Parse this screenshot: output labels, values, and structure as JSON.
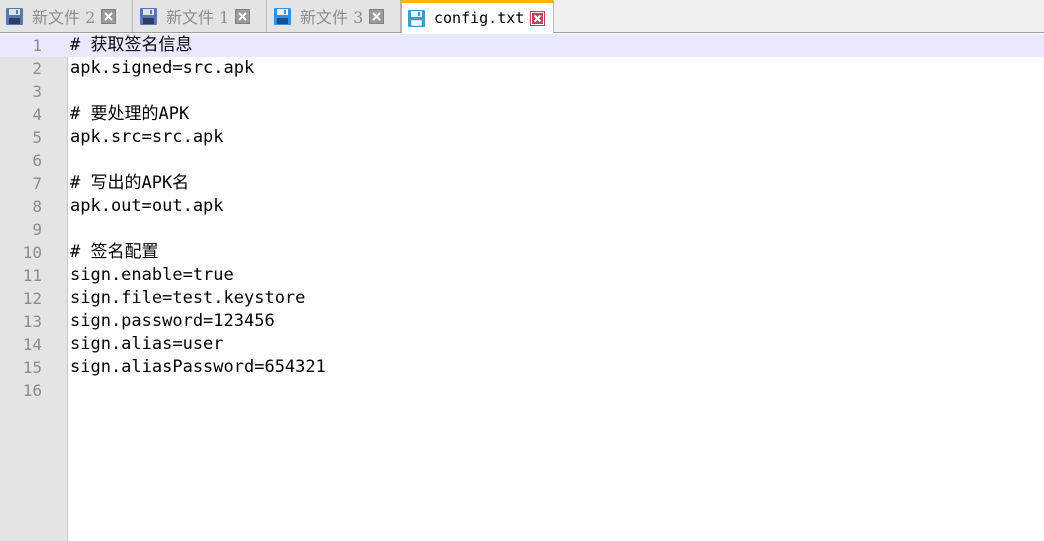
{
  "tabs": [
    {
      "label": "新文件 2",
      "icon": "save-icon-blue",
      "active": false
    },
    {
      "label": "新文件 1",
      "icon": "save-icon-blue",
      "active": false
    },
    {
      "label": "新文件 3",
      "icon": "save-icon-blue",
      "active": false
    },
    {
      "label": "config.txt",
      "icon": "save-icon-cyan",
      "active": true
    }
  ],
  "editor": {
    "current_line": 1,
    "lines": [
      {
        "no": "1",
        "text": "# 获取签名信息"
      },
      {
        "no": "2",
        "text": "apk.signed=src.apk"
      },
      {
        "no": "3",
        "text": ""
      },
      {
        "no": "4",
        "text": "# 要处理的APK"
      },
      {
        "no": "5",
        "text": "apk.src=src.apk"
      },
      {
        "no": "6",
        "text": ""
      },
      {
        "no": "7",
        "text": "# 写出的APK名"
      },
      {
        "no": "8",
        "text": "apk.out=out.apk"
      },
      {
        "no": "9",
        "text": ""
      },
      {
        "no": "10",
        "text": "# 签名配置"
      },
      {
        "no": "11",
        "text": "sign.enable=true"
      },
      {
        "no": "12",
        "text": "sign.file=test.keystore"
      },
      {
        "no": "13",
        "text": "sign.password=123456"
      },
      {
        "no": "14",
        "text": "sign.alias=user"
      },
      {
        "no": "15",
        "text": "sign.aliasPassword=654321"
      },
      {
        "no": "16",
        "text": ""
      }
    ]
  },
  "colors": {
    "active_tab_accent": "#fab700",
    "current_line_bg": "#e8e8ff",
    "gutter_bg": "#e4e4e4",
    "close_icon_active": "#c83c5a"
  }
}
